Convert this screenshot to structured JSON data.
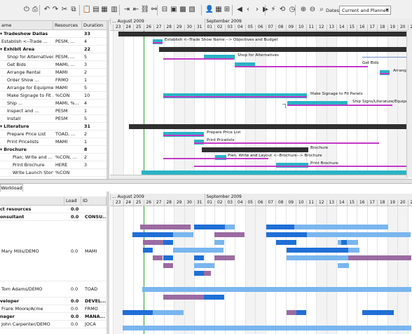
{
  "toolbar": {
    "buttons": [
      {
        "name": "save-icon",
        "glyph": "⏻"
      },
      {
        "name": "print-icon",
        "glyph": "⎙"
      },
      {
        "name": "undo-icon",
        "glyph": "↶"
      },
      {
        "name": "redo-icon",
        "glyph": "↷"
      },
      {
        "name": "cut-icon",
        "glyph": "✂"
      },
      {
        "name": "copy-icon",
        "glyph": "⧉"
      },
      {
        "name": "paste-icon",
        "glyph": "📋"
      },
      {
        "name": "task-icon",
        "glyph": "▤"
      },
      {
        "name": "insert-task-icon",
        "glyph": "▦"
      },
      {
        "name": "delete-task-icon",
        "glyph": "▥"
      },
      {
        "name": "indent-icon",
        "glyph": "⇥"
      },
      {
        "name": "outdent-icon",
        "glyph": "⇤"
      },
      {
        "name": "link-icon",
        "glyph": "⛓"
      },
      {
        "name": "unlink-icon",
        "glyph": "⚯"
      },
      {
        "name": "split-icon",
        "glyph": "⊟"
      },
      {
        "name": "calendar-icon",
        "glyph": "▣"
      },
      {
        "name": "properties-icon",
        "glyph": "▩"
      },
      {
        "name": "notes-icon",
        "glyph": "▧"
      },
      {
        "name": "resource-icon",
        "glyph": "👤"
      },
      {
        "name": "assign-icon",
        "glyph": "▦"
      },
      {
        "name": "scroll-to-task-icon",
        "glyph": "⊞"
      },
      {
        "name": "back-icon",
        "glyph": "◀"
      },
      {
        "name": "previous-icon",
        "glyph": "‹"
      },
      {
        "name": "next-icon",
        "glyph": "›"
      },
      {
        "name": "forward-icon",
        "glyph": "▶"
      },
      {
        "name": "critical-path-icon",
        "glyph": "⚡"
      },
      {
        "name": "history-icon",
        "glyph": "⟲"
      },
      {
        "name": "track-icon",
        "glyph": "◷"
      },
      {
        "name": "zoom-in-icon",
        "glyph": "⊕"
      },
      {
        "name": "zoom-out-icon",
        "glyph": "⊖"
      },
      {
        "name": "zoom-fit-icon",
        "glyph": "⌕"
      }
    ],
    "dates_label": "Dates",
    "dates_value": "Current and Planned"
  },
  "tasks": {
    "headers": {
      "name": "ame",
      "resources": "Resources",
      "duration": "Duration"
    },
    "rows": [
      {
        "name": "Tradeshow Dallas",
        "resources": "",
        "duration": "33",
        "indent": 0,
        "bold": true,
        "expand": "▾"
      },
      {
        "name": "Establish <--Trade ...",
        "resources": "PESM, ...",
        "duration": "4",
        "indent": 0,
        "bold": false,
        "expand": ""
      },
      {
        "name": "Exhibit Area",
        "resources": "",
        "duration": "22",
        "indent": 0,
        "bold": true,
        "expand": "▾"
      },
      {
        "name": "Shop for Alternatives",
        "resources": "PESM, ...",
        "duration": "5",
        "indent": 1,
        "bold": false,
        "expand": ""
      },
      {
        "name": "Get Bids",
        "resources": "MAMI, ...",
        "duration": "3",
        "indent": 1,
        "bold": false,
        "expand": ""
      },
      {
        "name": "Arrange Rental",
        "resources": "MAMI",
        "duration": "2",
        "indent": 1,
        "bold": false,
        "expand": ""
      },
      {
        "name": "Order Show ...",
        "resources": "FRMO",
        "duration": "1",
        "indent": 1,
        "bold": false,
        "expand": ""
      },
      {
        "name": "Arrange for Equipment",
        "resources": "MAMI",
        "duration": "5",
        "indent": 1,
        "bold": false,
        "expand": ""
      },
      {
        "name": "Make Signage to Fit ...",
        "resources": "%CON",
        "duration": "10",
        "indent": 1,
        "bold": false,
        "expand": ""
      },
      {
        "name": "Ship ...",
        "resources": "MAMI, %...",
        "duration": "4",
        "indent": 1,
        "bold": false,
        "expand": ""
      },
      {
        "name": "Inspect and ...",
        "resources": "PESM",
        "duration": "1",
        "indent": 1,
        "bold": false,
        "expand": ""
      },
      {
        "name": "Install",
        "resources": "PESM",
        "duration": "5",
        "indent": 1,
        "bold": false,
        "expand": ""
      },
      {
        "name": "Literature",
        "resources": "",
        "duration": "31",
        "indent": 0,
        "bold": true,
        "expand": "▾"
      },
      {
        "name": "Prepare Price List",
        "resources": "TOAD, ...",
        "duration": "2",
        "indent": 1,
        "bold": false,
        "expand": ""
      },
      {
        "name": "Print Pricelists",
        "resources": "MAMI",
        "duration": "1",
        "indent": 1,
        "bold": false,
        "expand": ""
      },
      {
        "name": "Brochure",
        "resources": "",
        "duration": "8",
        "indent": 1,
        "bold": true,
        "expand": "▾"
      },
      {
        "name": "Plan; Write and ...",
        "resources": "%CON, ...",
        "duration": "2",
        "indent": 2,
        "bold": false,
        "expand": ""
      },
      {
        "name": "Print Brochure",
        "resources": "HERE",
        "duration": "3",
        "indent": 2,
        "bold": false,
        "expand": ""
      },
      {
        "name": "Write Launch Story",
        "resources": "%CON",
        "duration": "",
        "indent": 2,
        "bold": false,
        "expand": ""
      }
    ]
  },
  "timeline": {
    "month1": "... August 2009",
    "month2": "September 2009",
    "days": [
      "23",
      "24",
      "25",
      "26",
      "27",
      "28",
      "29",
      "30",
      "31",
      "01",
      "02",
      "03",
      "04",
      "05",
      "06",
      "07",
      "08",
      "09",
      "10",
      "11",
      "12",
      "13",
      "14",
      "15",
      "16",
      "17",
      "18",
      "19",
      "20",
      "21",
      "22",
      "23"
    ]
  },
  "gantt_labels": [
    {
      "row": 1,
      "text": "Establish <--Trade Show Name --> Objectives and Budget"
    },
    {
      "row": 3,
      "text": "Shop for Alternatives"
    },
    {
      "row": 4,
      "text": "Get Bids"
    },
    {
      "row": 5,
      "text": "Arrange Re"
    },
    {
      "row": 8,
      "text": "Make Signage to Fit Panels"
    },
    {
      "row": 9,
      "text": "Ship Signs/Literature/Equipment"
    },
    {
      "row": 13,
      "text": "Prepare Price List"
    },
    {
      "row": 14,
      "text": "Print Pricelists"
    },
    {
      "row": 15,
      "text": "Brochure"
    },
    {
      "row": 16,
      "text": "Plan, Write and Layout <--Brochure--> Brochure"
    },
    {
      "row": 17,
      "text": "Print Brochure"
    }
  ],
  "workload": {
    "tab_label": "Workload",
    "headers": {
      "name": "ct resources",
      "load": "Load",
      "id": "ID"
    },
    "rows": [
      {
        "name": "ct resources",
        "load": "0.0",
        "id": "",
        "bold": true,
        "h": 11
      },
      {
        "name": "onsultant",
        "load": "0.0",
        "id": "CONSU...",
        "bold": true,
        "h": 11
      },
      {
        "name": "Mary Mills/DEMO",
        "load": "0.0",
        "id": "MAMI",
        "bold": false,
        "h": 86
      },
      {
        "name": "Tom Adams/DEMO",
        "load": "0.0",
        "id": "TOAD",
        "bold": false,
        "h": 23
      },
      {
        "name": "veloper",
        "load": "0.0",
        "id": "DEVEL...",
        "bold": true,
        "h": 11
      },
      {
        "name": "Frank Moore/Acme",
        "load": "0.0",
        "id": "FRMO",
        "bold": false,
        "h": 11
      },
      {
        "name": "nager",
        "load": "0.0",
        "id": "MANA...",
        "bold": true,
        "h": 11
      },
      {
        "name": "John Carpenter/DEMO",
        "load": "0.0",
        "id": "JOCA",
        "bold": false,
        "h": 11
      }
    ]
  },
  "colors": {
    "summary_bar": "#2f2f2f",
    "task_bar": "#2ab3c5",
    "baseline": "#c339c8",
    "dark_blue": "#1f6fd6",
    "light_blue": "#79b6ef",
    "purple": "#9b6ba2",
    "today_line": "#27a427"
  }
}
